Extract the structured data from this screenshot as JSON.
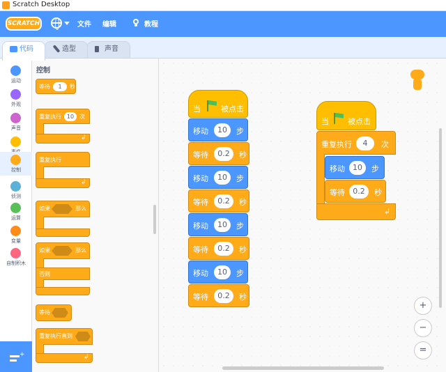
{
  "window": {
    "title": "Scratch Desktop"
  },
  "menubar": {
    "logo": "SCRATCH",
    "file": "文件",
    "edit": "编辑",
    "tutorials": "教程"
  },
  "tabs": [
    {
      "label": "代码",
      "icon": "code-icon",
      "active": true
    },
    {
      "label": "造型",
      "icon": "brush-icon",
      "active": false
    },
    {
      "label": "声音",
      "icon": "speaker-icon",
      "active": false
    }
  ],
  "categories": [
    {
      "label": "运动",
      "color": "#4c97ff"
    },
    {
      "label": "外观",
      "color": "#9966ff"
    },
    {
      "label": "声音",
      "color": "#cf63cf"
    },
    {
      "label": "事件",
      "color": "#ffbf00"
    },
    {
      "label": "控制",
      "color": "#ffab19"
    },
    {
      "label": "侦测",
      "color": "#5cb1d6"
    },
    {
      "label": "运算",
      "color": "#59c059"
    },
    {
      "label": "变量",
      "color": "#ff8c1a"
    },
    {
      "label": "自制积木",
      "color": "#ff6680"
    }
  ],
  "palette": {
    "title": "控制",
    "wait": {
      "label": "等待",
      "value": "1",
      "unit": "秒"
    },
    "repeat": {
      "label": "重复执行",
      "value": "10",
      "unit": "次"
    },
    "forever": {
      "label": "重复执行"
    },
    "if_then": {
      "if": "如果",
      "then": "那么"
    },
    "if_else": {
      "if": "如果",
      "then": "那么",
      "else": "否则"
    },
    "wait_until": {
      "label": "等待"
    },
    "repeat_until": {
      "label": "重复执行直到"
    }
  },
  "script1": {
    "hat": {
      "when": "当",
      "clicked": "被点击"
    },
    "blocks": [
      {
        "label": "移动",
        "value": "10",
        "unit": "步"
      },
      {
        "label": "等待",
        "value": "0.2",
        "unit": "秒"
      },
      {
        "label": "移动",
        "value": "10",
        "unit": "步"
      },
      {
        "label": "等待",
        "value": "0.2",
        "unit": "秒"
      },
      {
        "label": "移动",
        "value": "10",
        "unit": "步"
      },
      {
        "label": "等待",
        "value": "0.2",
        "unit": "秒"
      },
      {
        "label": "移动",
        "value": "10",
        "unit": "步"
      },
      {
        "label": "等待",
        "value": "0.2",
        "unit": "秒"
      }
    ]
  },
  "script2": {
    "hat": {
      "when": "当",
      "clicked": "被点击"
    },
    "repeat": {
      "label": "重复执行",
      "value": "4",
      "unit": "次"
    },
    "move": {
      "label": "移动",
      "value": "10",
      "unit": "步"
    },
    "wait": {
      "label": "等待",
      "value": "0.2",
      "unit": "秒"
    }
  },
  "zoom": {
    "in": "+",
    "out": "−",
    "reset": "="
  }
}
